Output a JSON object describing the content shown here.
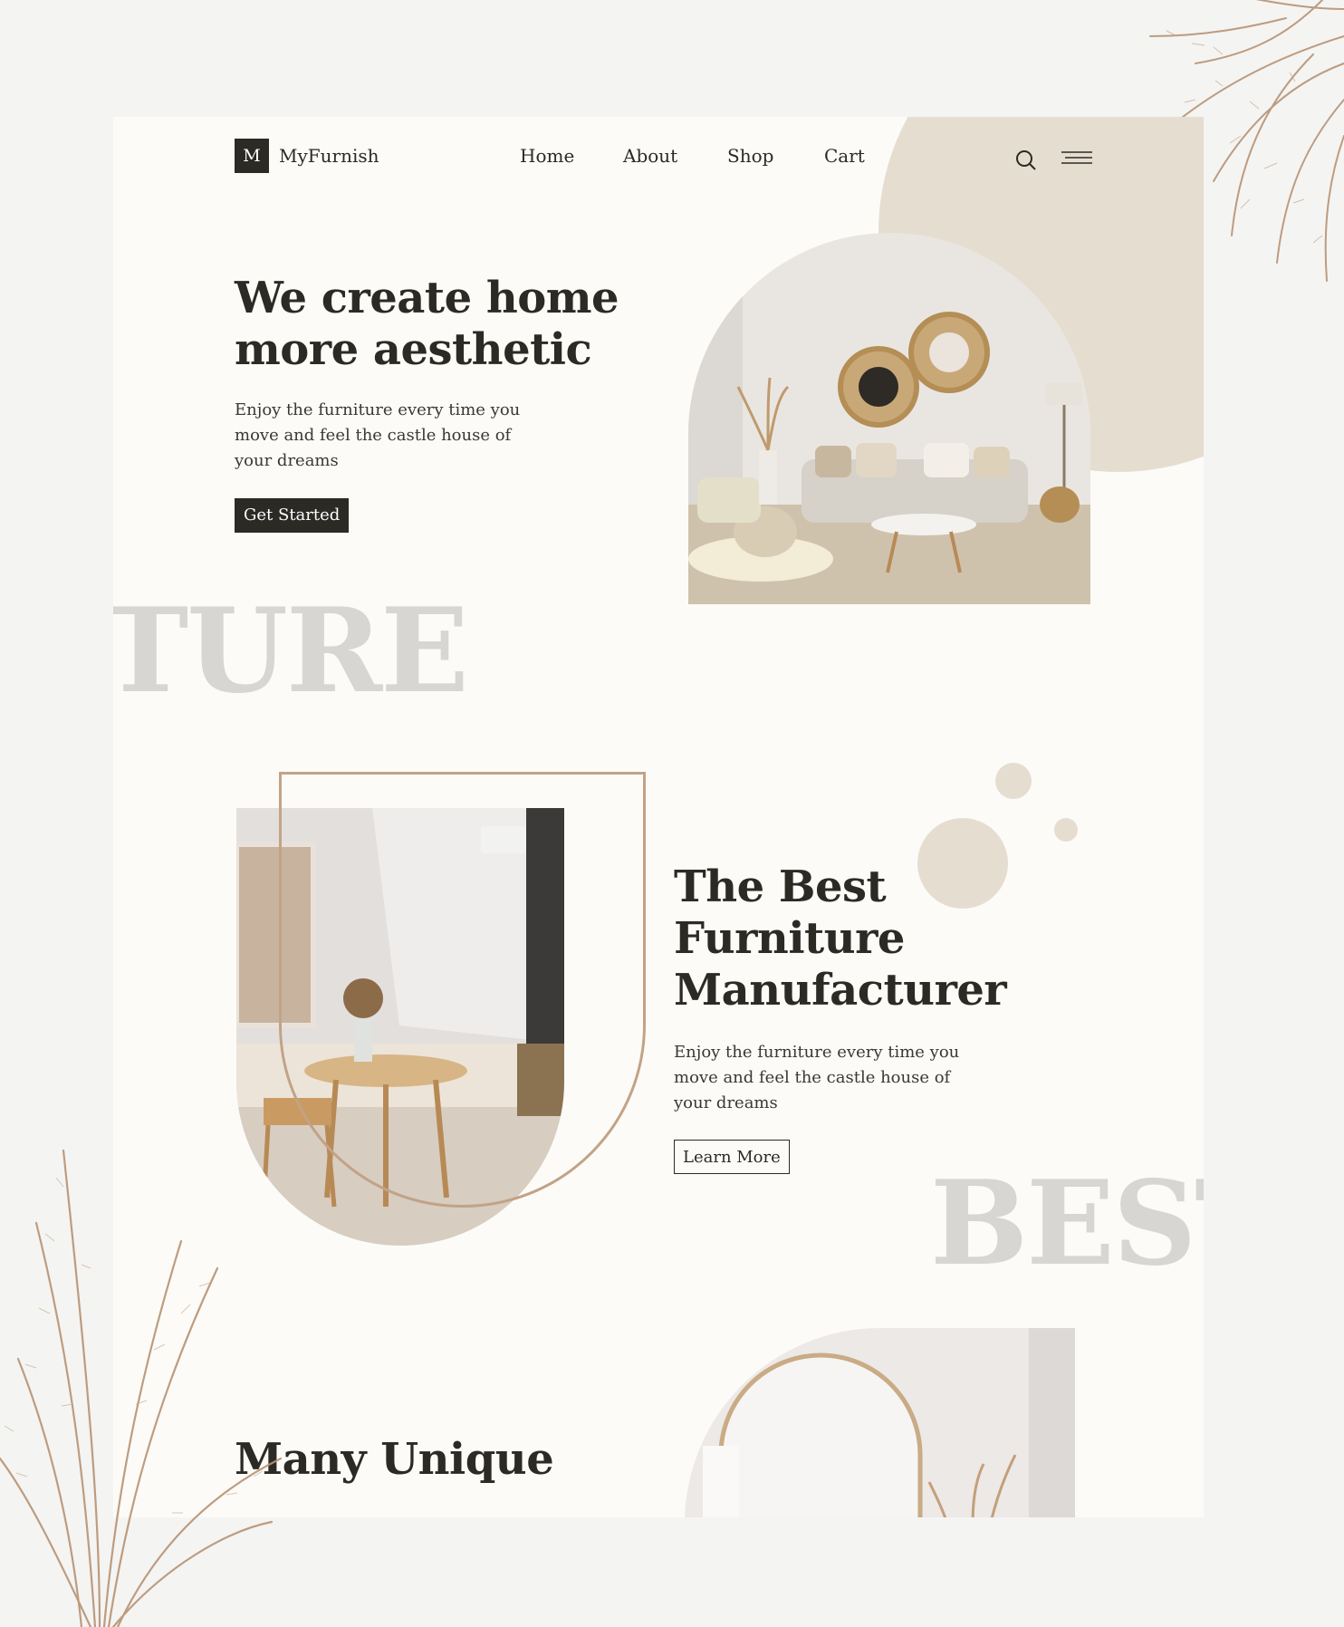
{
  "brand": {
    "logo_letter": "M",
    "name": "MyFurnish"
  },
  "nav": {
    "items": [
      "Home",
      "About",
      "Shop",
      "Cart"
    ]
  },
  "icons": {
    "search": "search-icon",
    "menu": "hamburger-menu-icon"
  },
  "hero": {
    "title": "We create home more aesthetic",
    "subtitle": "Enjoy the furniture every time you move and feel the castle house of your dreams",
    "cta_label": "Get Started",
    "background_word": "TURE"
  },
  "section2": {
    "title": "The Best Furniture Manufacturer",
    "subtitle": "Enjoy the furniture every time you move and feel the castle house of your dreams",
    "cta_label": "Learn More",
    "background_word": "BEST"
  },
  "section3": {
    "title": "Many Unique"
  },
  "colors": {
    "accent_dark": "#2b2a25",
    "beige": "#e6ddd1",
    "frame_tan": "#c2a387",
    "ghost_text": "#d8d6d2",
    "page_bg": "#fcfbf8"
  }
}
